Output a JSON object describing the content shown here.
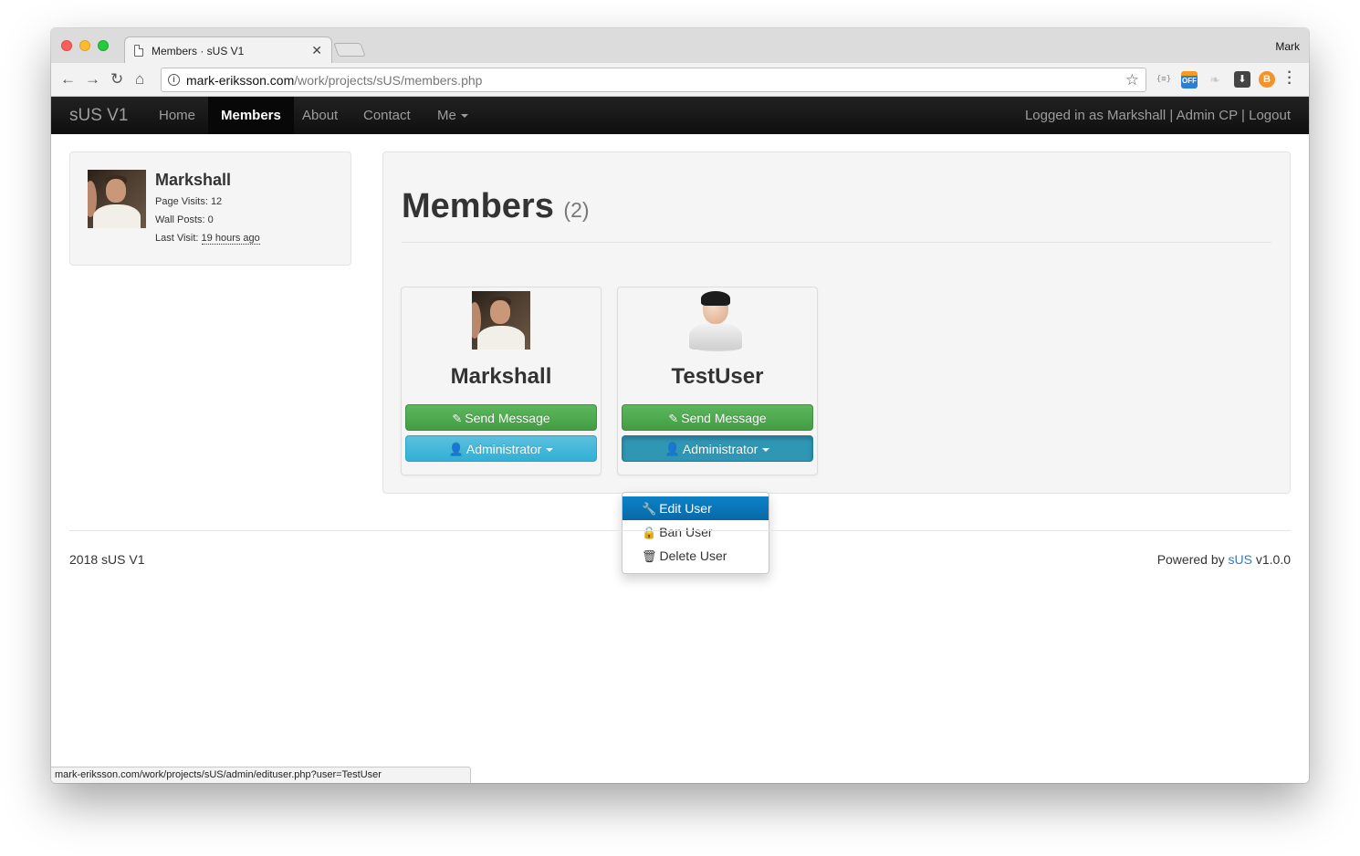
{
  "browser": {
    "tab_title": "Members · sUS V1",
    "profile_name": "Mark",
    "url_host": "mark-eriksson.com",
    "url_path": "/work/projects/sUS/members.php",
    "status_url": "mark-eriksson.com/work/projects/sUS/admin/edituser.php?user=TestUser"
  },
  "navbar": {
    "brand": "sUS V1",
    "items": [
      {
        "label": "Home"
      },
      {
        "label": "Members"
      },
      {
        "label": "About"
      },
      {
        "label": "Contact"
      },
      {
        "label": "Me"
      }
    ],
    "logged_in_prefix": "Logged in as ",
    "username": "Markshall",
    "sep": " | ",
    "admin_cp": "Admin CP",
    "logout": "Logout"
  },
  "profile": {
    "name": "Markshall",
    "page_visits": "Page Visits: 12",
    "wall_posts": "Wall Posts: 0",
    "last_visit_label": "Last Visit: ",
    "last_visit_value": "19 hours ago"
  },
  "members": {
    "title": "Members",
    "count": "(2)",
    "cards": [
      {
        "name": "Markshall",
        "message_btn": "Send Message",
        "role_btn": "Administrator"
      },
      {
        "name": "TestUser",
        "message_btn": "Send Message",
        "role_btn": "Administrator"
      }
    ]
  },
  "dropdown": {
    "items": [
      {
        "label": "Edit User",
        "icon": "wrench-icon"
      },
      {
        "label": "Ban User",
        "icon": "lock-icon"
      },
      {
        "label": "Delete User",
        "icon": "trash-icon"
      }
    ]
  },
  "footer": {
    "left": "2018 sUS V1",
    "powered_prefix": "Powered by ",
    "powered_link": "sUS",
    "version": " v1.0.0"
  },
  "colors": {
    "navbar": "#111111",
    "success": "#5cb85c",
    "info": "#5bc0de",
    "dropdown_active": "#0a81c7",
    "link": "#337ab7"
  }
}
